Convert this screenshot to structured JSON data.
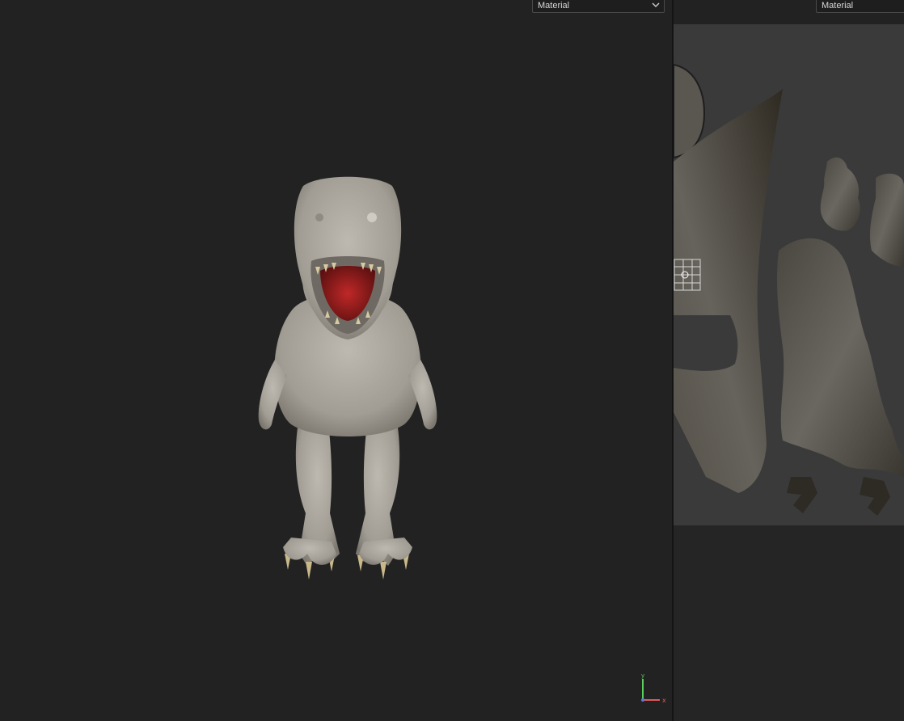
{
  "viewport_3d": {
    "shading_dropdown": {
      "value": "Material",
      "icon": "chevron-down-icon"
    },
    "axis_gizmo": {
      "x_label": "x",
      "y_label": "y"
    }
  },
  "viewport_2d": {
    "shading_dropdown": {
      "value": "Material",
      "icon": "chevron-down-icon"
    }
  },
  "colors": {
    "background": "#222222",
    "divider": "#141414",
    "uv_area": "#3a3a3a",
    "model_skin": "#a9a59c",
    "mouth": "#8c1c1c",
    "axis_x": "#e05a5a",
    "axis_y": "#5ad05a",
    "axis_z": "#5a7ae0"
  }
}
